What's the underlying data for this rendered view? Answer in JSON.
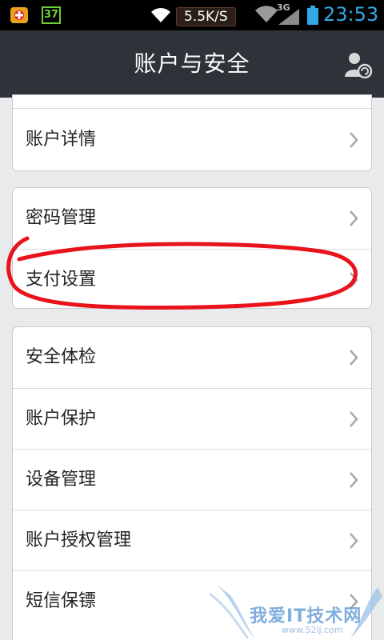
{
  "status_bar": {
    "notification_badge": "37",
    "network_speed": "5.5K/S",
    "network_type": "3G",
    "time": "23:53",
    "icons": [
      "app-notification-icon",
      "wifi-icon",
      "wifi-icon",
      "signal-icon",
      "battery-icon"
    ]
  },
  "header": {
    "title": "账户与安全",
    "right_icon": "switch-account-icon"
  },
  "groups": [
    {
      "items": [
        {
          "label": "账户详情"
        }
      ]
    },
    {
      "items": [
        {
          "label": "密码管理"
        },
        {
          "label": "支付设置"
        }
      ]
    },
    {
      "items": [
        {
          "label": "安全体检"
        },
        {
          "label": "账户保护"
        },
        {
          "label": "设备管理"
        },
        {
          "label": "账户授权管理"
        },
        {
          "label": "短信保镖"
        }
      ]
    }
  ],
  "annotation": {
    "color": "#e8131b",
    "target": "支付设置"
  },
  "watermark": {
    "text": "我爱IT技术网",
    "url": "www.52ij.com"
  },
  "colors": {
    "title_bar": "#2d3338",
    "status_time": "#33a8e6",
    "background": "#e9eaec",
    "chevron": "#a8a8a8"
  }
}
